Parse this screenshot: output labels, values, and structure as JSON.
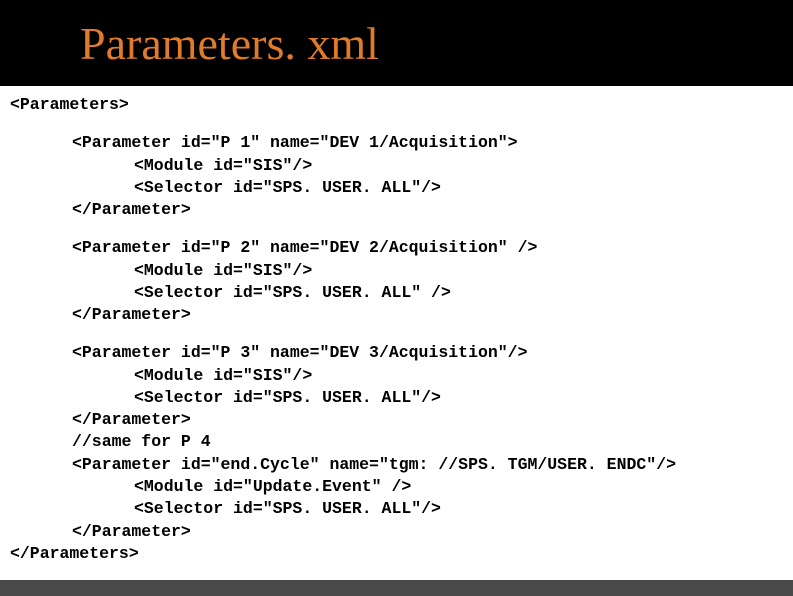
{
  "title": "Parameters. xml",
  "lines": {
    "l0": "<Parameters>",
    "p1a": "<Parameter id=\"P 1\" name=\"DEV 1/Acquisition\">",
    "p1b": "<Module id=\"SIS\"/>",
    "p1c": "<Selector id=\"SPS. USER. ALL\"/>",
    "p1d": "</Parameter>",
    "p2a": "<Parameter id=\"P 2\" name=\"DEV 2/Acquisition\" />",
    "p2b": "<Module id=\"SIS\"/>",
    "p2c": "<Selector id=\"SPS. USER. ALL\" />",
    "p2d": "</Parameter>",
    "p3a": "<Parameter id=\"P 3\" name=\"DEV 3/Acquisition\"/>",
    "p3b": "<Module id=\"SIS\"/>",
    "p3c": "<Selector id=\"SPS. USER. ALL\"/>",
    "p3d": "</Parameter>",
    "p4": "//same for P 4",
    "p5a": "<Parameter id=\"end.Cycle\" name=\"tgm: //SPS. TGM/USER. ENDC\"/>",
    "p5b": "<Module id=\"Update.Event\" />",
    "p5c": "<Selector id=\"SPS. USER. ALL\"/>",
    "p5d": "</Parameter>",
    "l1": "</Parameters>"
  }
}
